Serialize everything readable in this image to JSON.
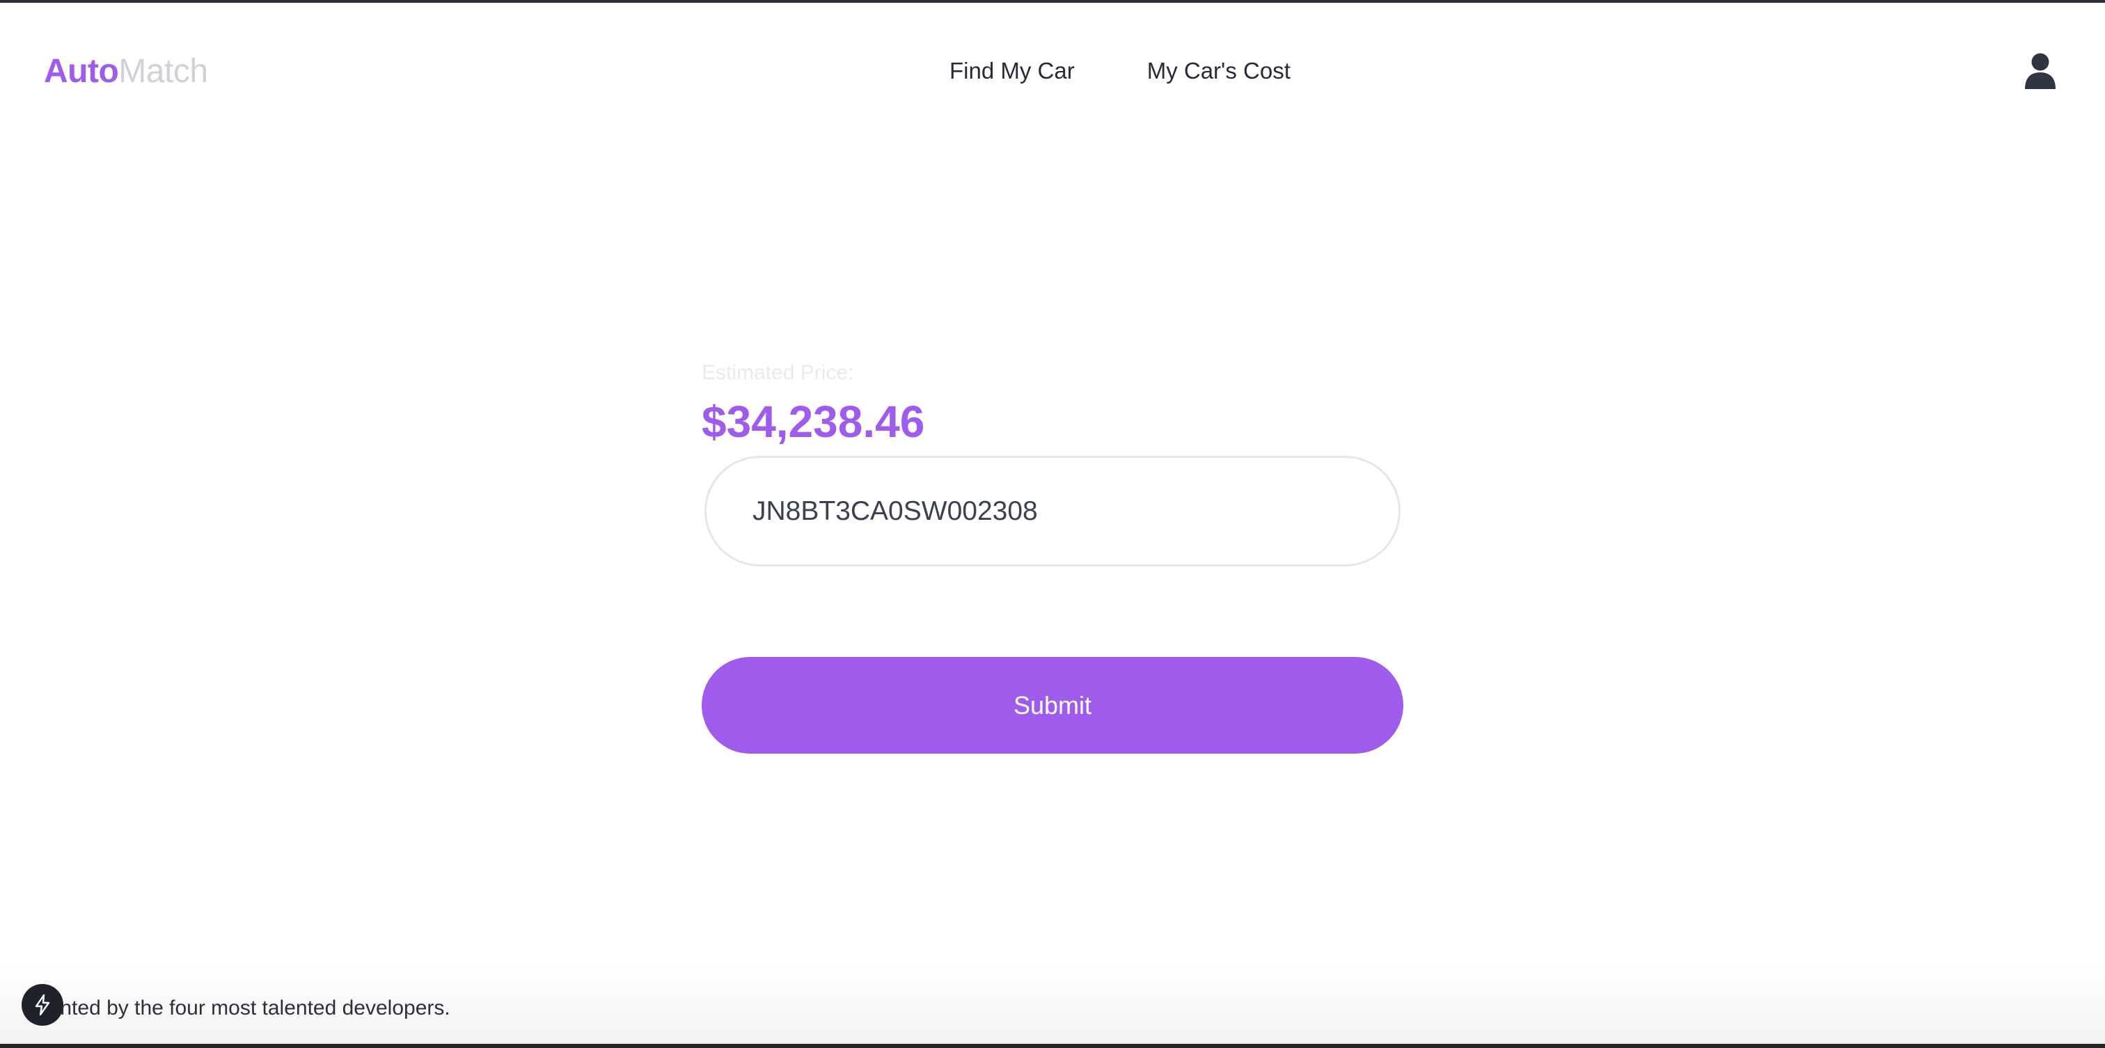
{
  "header": {
    "logo_primary": "Auto",
    "logo_secondary": "Match",
    "nav": [
      {
        "label": "Find My Car"
      },
      {
        "label": "My Car's Cost"
      }
    ],
    "user_icon": "user-icon"
  },
  "main": {
    "price_label": "Estimated Price:",
    "price_value": "$34,238.46",
    "vin_input_value": "JN8BT3CA0SW002308",
    "submit_label": "Submit"
  },
  "footer": {
    "text": "Presented by the four most talented developers.",
    "bolt_icon": "lightning-icon"
  },
  "colors": {
    "accent": "#9f5bec",
    "text": "#262b36"
  }
}
